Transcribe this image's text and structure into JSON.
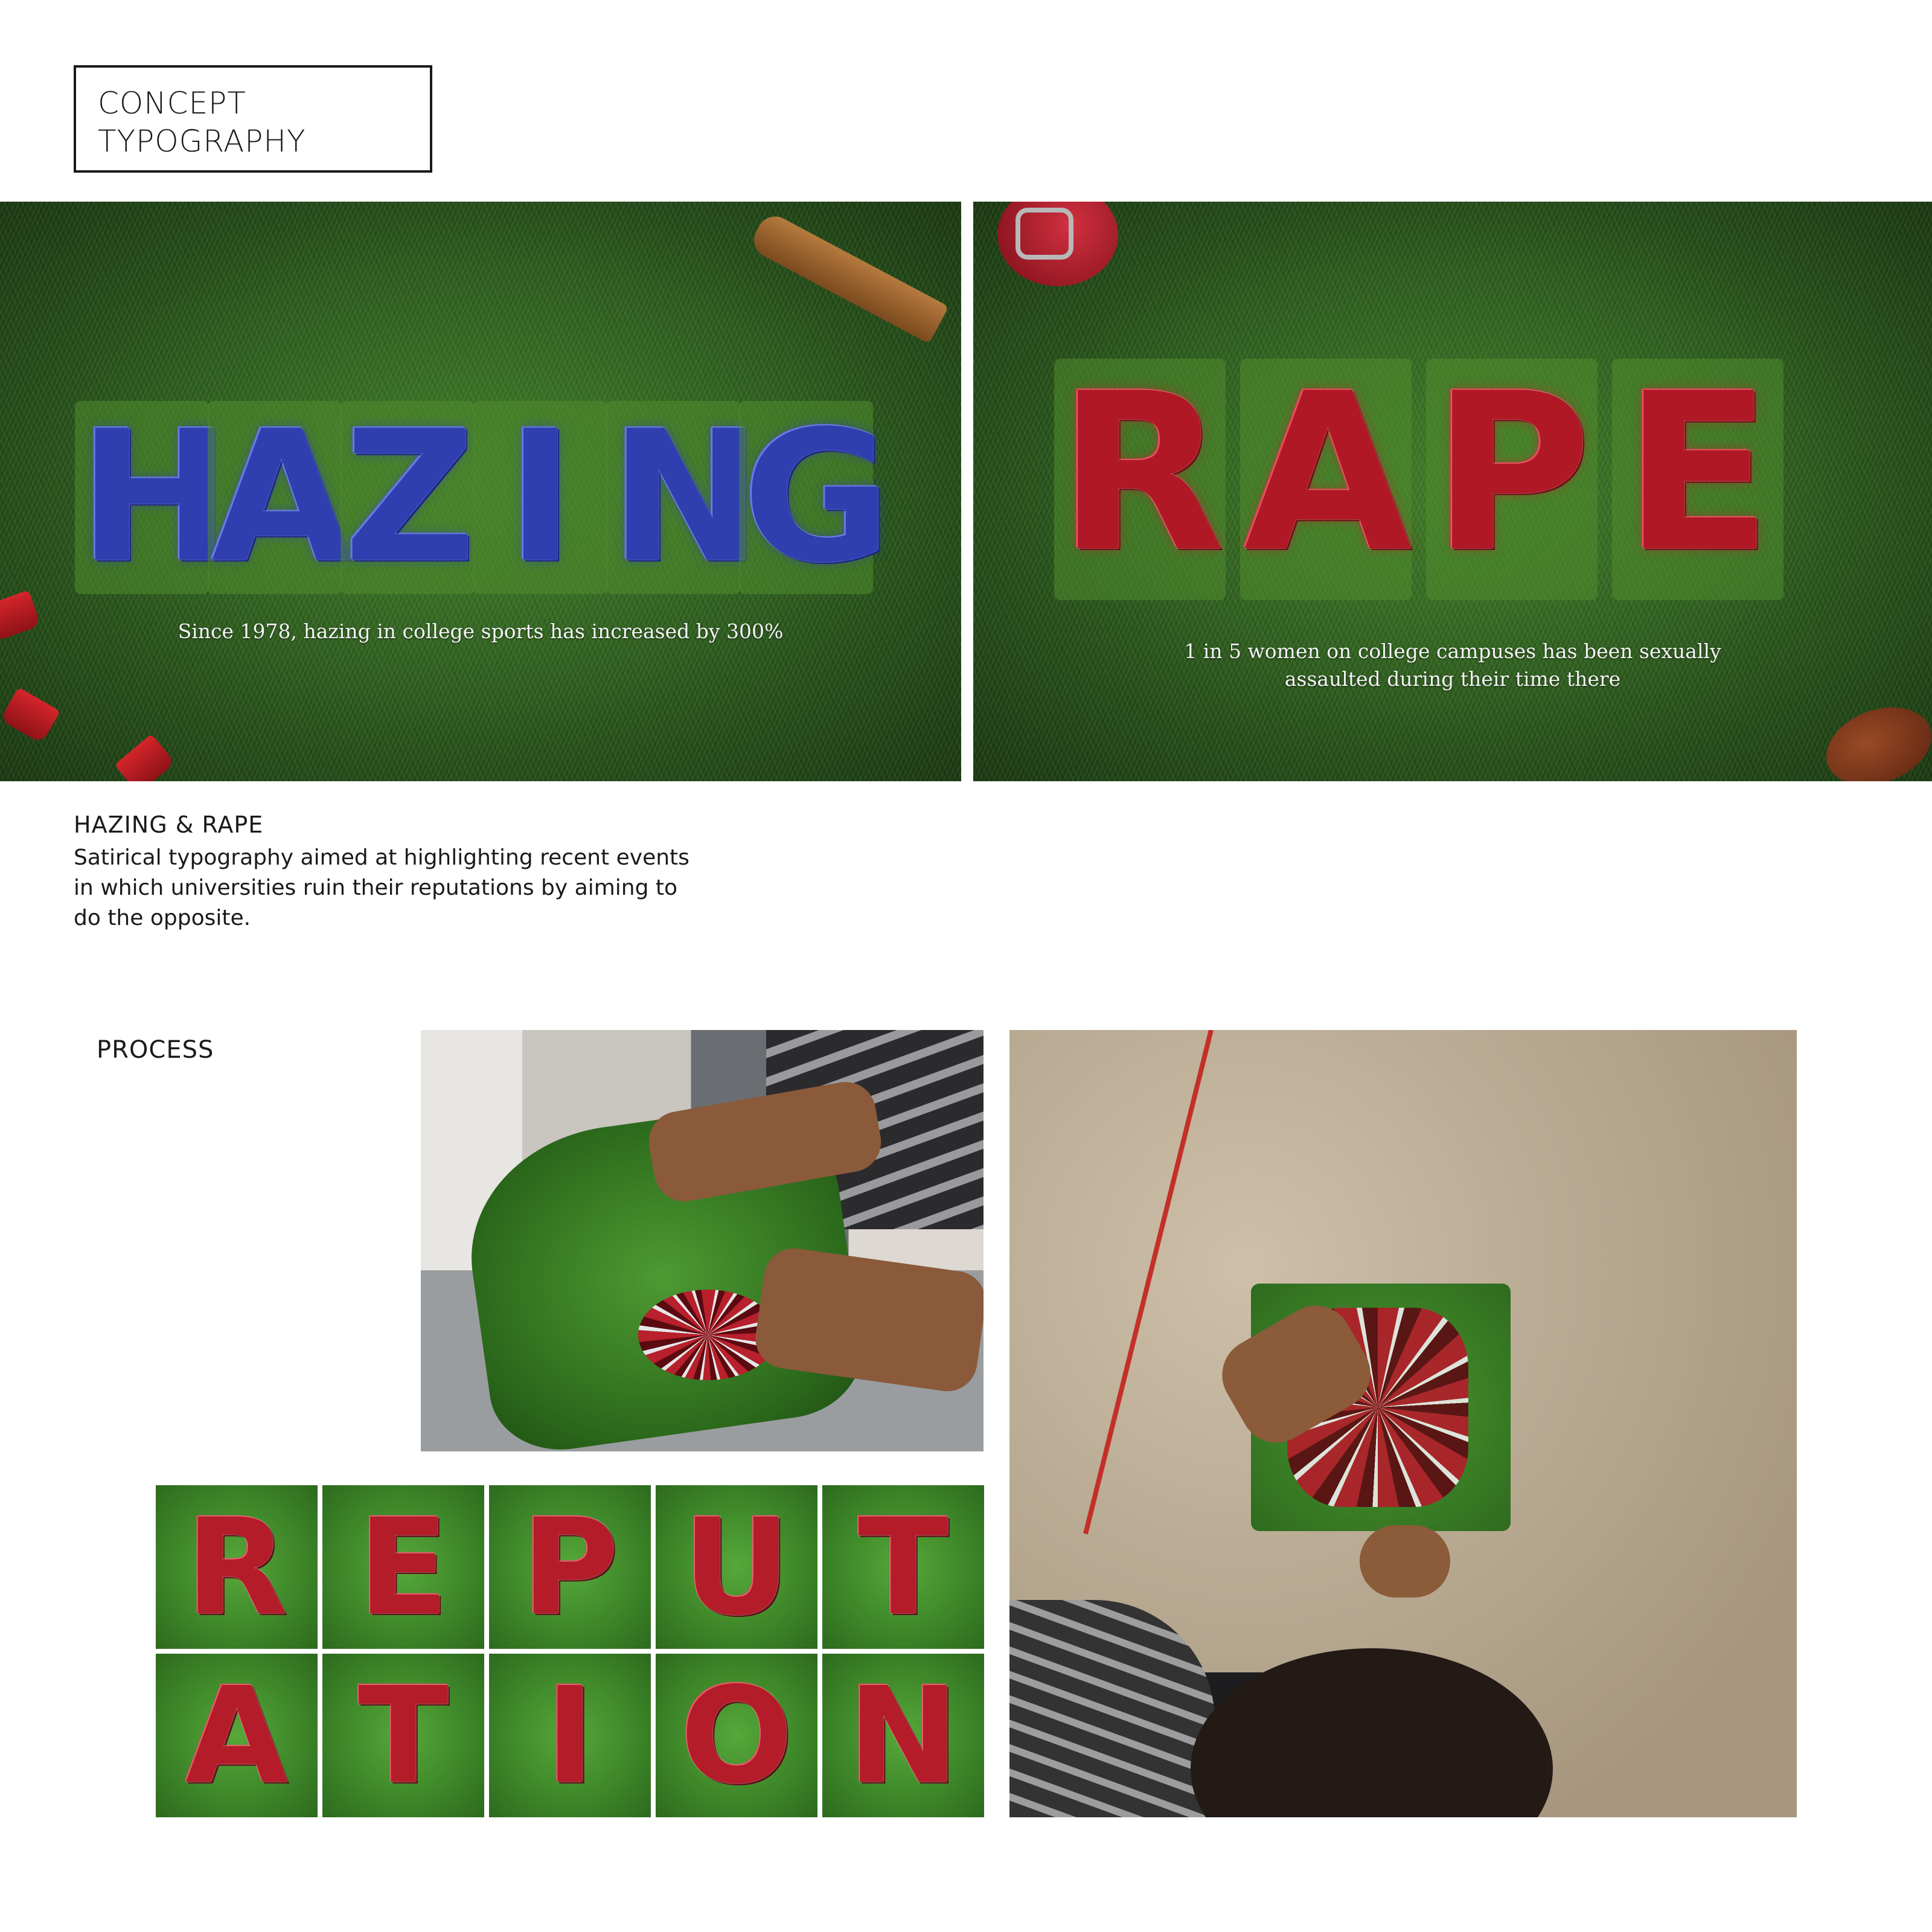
{
  "title": {
    "line1": "CONCEPT",
    "line2": "TYPOGRAPHY"
  },
  "panels": {
    "hazing": {
      "word_letters": [
        "H",
        "A",
        "Z",
        "I",
        "N",
        "G"
      ],
      "caption": "Since 1978, hazing in college sports has increased by 300%",
      "letter_color": "#2f3fb0"
    },
    "rape": {
      "word_letters": [
        "R",
        "A",
        "P",
        "E"
      ],
      "caption_line1": "1 in 5 women on college campuses has been sexually",
      "caption_line2": "assaulted during their time there",
      "letter_color": "#b01826"
    }
  },
  "description": {
    "title": "HAZING & RAPE",
    "body_line1": "Satirical typography aimed at highlighting recent events",
    "body_line2": "in which universities ruin their reputations by aiming to",
    "body_line3": "do the opposite."
  },
  "process": {
    "label": "PROCESS",
    "tiles": [
      "R",
      "E",
      "P",
      "U",
      "T",
      "A",
      "T",
      "I",
      "O",
      "N"
    ]
  }
}
